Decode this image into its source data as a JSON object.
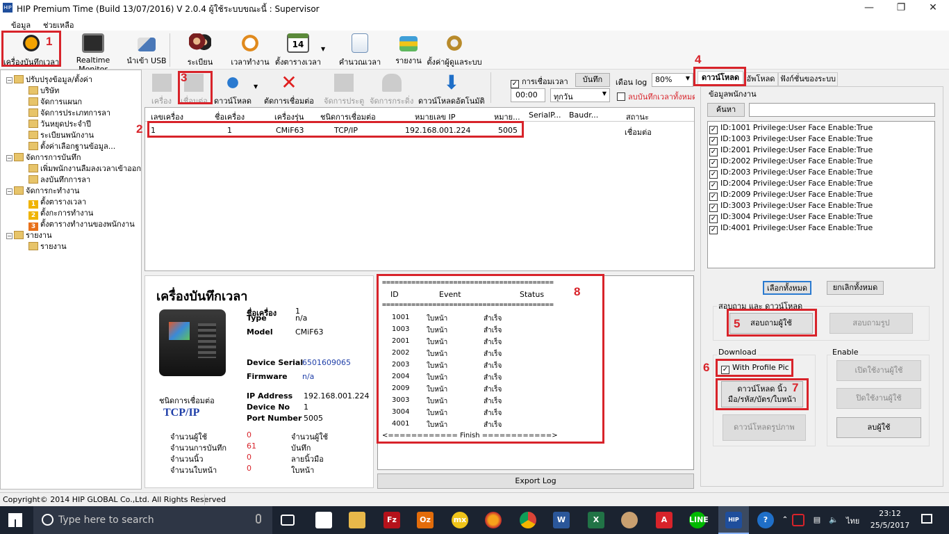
{
  "window": {
    "title": "HIP Premium Time (Build 13/07/2016) V 2.0.4   ผู้ใช้ระบบขณะนี้ : Supervisor",
    "app_icon": "HIP"
  },
  "menu": [
    "ข้อมูล",
    "ช่วยเหลือ"
  ],
  "toolbar": [
    {
      "label": "เครื่องบันทึกเวลา",
      "icon": "alarm-clock-icon",
      "color": "#c0392b"
    },
    {
      "label": "Realtime Monitor",
      "icon": "monitor-icon",
      "color": "#3a6b3a"
    },
    {
      "label": "นำเข้า USB",
      "icon": "usb-icon",
      "color": "#4a78b8"
    },
    {
      "label": "ระเบียนพนักงาน",
      "icon": "users-icon",
      "color": "#8b2b2b"
    },
    {
      "label": "เวลาทำงาน",
      "icon": "stopwatch-icon",
      "color": "#e08a1e"
    },
    {
      "label": "ตั้งตารางเวลา",
      "icon": "calendar-icon",
      "color": "#5b8a3a"
    },
    {
      "label": "คำนวณเวลาทำงาน",
      "icon": "document-icon",
      "color": "#6d8fb6"
    },
    {
      "label": "รายงาน",
      "icon": "report-icon",
      "color": "#3f9fd8"
    },
    {
      "label": "ตั้งค่าผู้ดูแลระบบ",
      "icon": "admin-settings-icon",
      "color": "#b88a2a"
    }
  ],
  "calendar_day": "14",
  "tree": [
    {
      "label": "ปรับปรุงข้อมูล/ตั้งค่า",
      "level": 0
    },
    {
      "label": "บริษัท",
      "level": 1
    },
    {
      "label": "จัดการแผนก",
      "level": 1
    },
    {
      "label": "จัดการประเภทการลา",
      "level": 1
    },
    {
      "label": "วันหยุดประจำปี",
      "level": 1
    },
    {
      "label": "ระเบียนพนักงาน",
      "level": 1
    },
    {
      "label": "ตั้งค่าเลือกฐานข้อมูล...",
      "level": 1
    },
    {
      "label": "จัดการการบันทึก",
      "level": 0
    },
    {
      "label": "เพิ่มพนักงานลืมลงเวลาเข้าออก",
      "level": 1
    },
    {
      "label": "ลงบันทึกการลา",
      "level": 1
    },
    {
      "label": "จัดการกะทำงาน",
      "level": 0
    },
    {
      "label": "ตั้งตารางเวลา",
      "level": 1,
      "badge": "1"
    },
    {
      "label": "ตั้งกะการทำงาน",
      "level": 1,
      "badge": "2"
    },
    {
      "label": "ตั้งตารางทำงานของพนักงาน",
      "level": 1,
      "badge": "3"
    },
    {
      "label": "รายงาน",
      "level": 0
    },
    {
      "label": "รายงาน",
      "level": 1
    }
  ],
  "device_toolbar": {
    "buttons": [
      "เครื่อง",
      "เชื่อมต่อ",
      "ดาวน์โหลด",
      "ตัดการเชื่อมต่อ",
      "จัดการประตู",
      "จัดการกระดิ่ง",
      "ดาวน์โหลดอัตโนมัติ"
    ],
    "connect_time_label": "การเชื่อมเวลา",
    "connect_time_checked": true,
    "save_label": "บันทึก",
    "month_log_label": "เดือน log",
    "zoom": "80%",
    "time_value": "00:00",
    "day_value": "ทุกวัน",
    "delete_label": "ลบบันทึกเวลาทั้งหมด"
  },
  "grid": {
    "headers": [
      "เลขเครื่อง",
      "ชื่อเครื่อง",
      "เครื่องรุ่น",
      "ชนิดการเชื่อมต่อ",
      "หมายเลข IP",
      "หมาย...",
      "SerialP...",
      "Baudr...",
      "สถานะ"
    ],
    "rows": [
      [
        "1",
        "1",
        "CMiF63",
        "TCP/IP",
        "192.168.001.224",
        "5005",
        "",
        "",
        "เชื่อมต่อ"
      ]
    ]
  },
  "device_info": {
    "heading": "เครื่องบันทึกเวลา",
    "name_label": "ชื่อเครื่อง",
    "name_value": "1",
    "type_label": "Type",
    "type_value": "n/a",
    "model_label": "Model",
    "model_value": "CMiF63",
    "serial_label": "Device Serial",
    "serial_value": "6501609065",
    "firmware_label": "Firmware",
    "firmware_value": "n/a",
    "conn_label": "ชนิดการเชื่อมต่อ",
    "conn_value": "TCP/IP",
    "ip_label": "IP Address",
    "ip_value": "192.168.001.224",
    "devno_label": "Device No",
    "devno_value": "1",
    "port_label": "Port Number",
    "port_value": "5005",
    "stats": [
      {
        "label": "จำนวนผู้ใช้",
        "value": "0",
        "unit": "จำนวนผู้ใช้"
      },
      {
        "label": "จำนวนการบันทึก",
        "value": "61",
        "unit": "บันทึก"
      },
      {
        "label": "จำนวนนิ้ว",
        "value": "0",
        "unit": "ลายนิ้วมือ"
      },
      {
        "label": "จำนวนใบหน้า",
        "value": "0",
        "unit": "ใบหน้า"
      }
    ]
  },
  "log": {
    "sep": "=========================================",
    "h_id": "ID",
    "h_event": "Event",
    "h_status": "Status",
    "entries": [
      [
        "1001",
        "ใบหน้า",
        "สำเร็จ"
      ],
      [
        "1003",
        "ใบหน้า",
        "สำเร็จ"
      ],
      [
        "2001",
        "ใบหน้า",
        "สำเร็จ"
      ],
      [
        "2002",
        "ใบหน้า",
        "สำเร็จ"
      ],
      [
        "2003",
        "ใบหน้า",
        "สำเร็จ"
      ],
      [
        "2004",
        "ใบหน้า",
        "สำเร็จ"
      ],
      [
        "2009",
        "ใบหน้า",
        "สำเร็จ"
      ],
      [
        "3003",
        "ใบหน้า",
        "สำเร็จ"
      ],
      [
        "3004",
        "ใบหน้า",
        "สำเร็จ"
      ],
      [
        "4001",
        "ใบหน้า",
        "สำเร็จ"
      ]
    ],
    "finish": "<============ Finish ============>",
    "export_label": "Export Log"
  },
  "right": {
    "tabs": [
      "ดาวน์โหลด",
      "อัพโหลด",
      "ฟังก์ชั่นของระบบ"
    ],
    "group_label": "ข้อมูลพนักงาน",
    "search_button": "ค้นหา",
    "search_value": "",
    "employees": [
      "ID:1001 Privilege:User Face Enable:True",
      "ID:1003 Privilege:User Face Enable:True",
      "ID:2001 Privilege:User Face Enable:True",
      "ID:2002 Privilege:User Face Enable:True",
      "ID:2003 Privilege:User Face Enable:True",
      "ID:2004 Privilege:User Face Enable:True",
      "ID:2009 Privilege:User Face Enable:True",
      "ID:3003 Privilege:User Face Enable:True",
      "ID:3004 Privilege:User Face Enable:True",
      "ID:4001 Privilege:User Face Enable:True"
    ],
    "select_all": "เลือกทั้งหมด",
    "deselect_all": "ยกเลิกทั้งหมด",
    "query_group": "สอบถาม และ ดาวน์โหลด",
    "query_user": "สอบถามผู้ใช้",
    "query_photo": "สอบถามรูป",
    "download_group": "Download",
    "enable_group": "Enable",
    "with_profile": "With Profile Pic",
    "with_profile_checked": true,
    "download_fp_line1": "ดาวน์โหลด นิ้ว",
    "download_fp_line2": "มือ/รหัส/บัตร/ใบหน้า",
    "download_photo": "ดาวน์โหลดรูปภาพ",
    "enable_user": "เปิดใช้งานผู้ใช้",
    "disable_user": "ปิดใช้งานผู้ใช้",
    "delete_user": "ลบผู้ใช้"
  },
  "annotations": [
    "1",
    "2",
    "3",
    "4",
    "5",
    "6",
    "7",
    "8"
  ],
  "status": "Copyright© 2014 HIP GLOBAL Co.,Ltd. All Rights Reserved",
  "taskbar": {
    "search_placeholder": "Type here to search",
    "lang": "ไทย",
    "time": "23:12",
    "date": "25/5/2017"
  }
}
